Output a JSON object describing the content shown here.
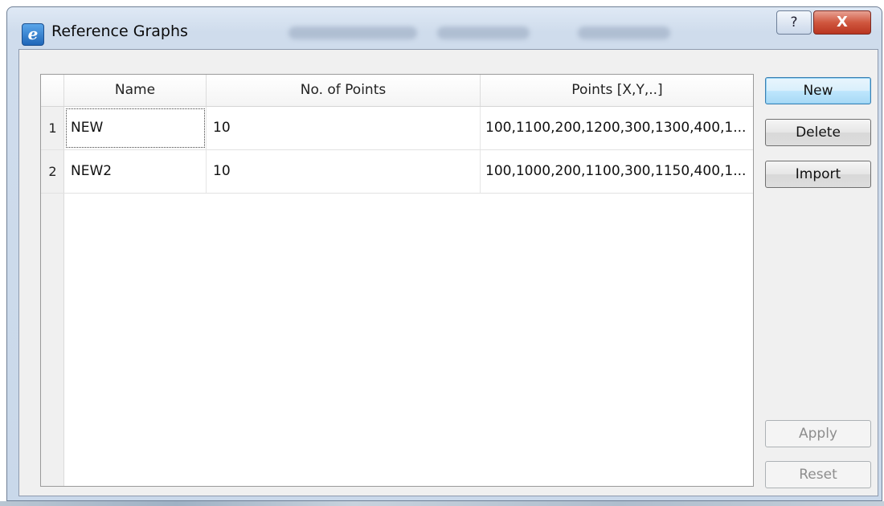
{
  "window": {
    "title": "Reference Graphs",
    "app_icon_glyph": "e",
    "help_glyph": "?",
    "close_glyph": "X"
  },
  "table": {
    "columns": [
      "Name",
      "No. of Points",
      "Points [X,Y,..]"
    ],
    "rows": [
      {
        "index": "1",
        "name": "NEW",
        "points_count": "10",
        "points": "100,1100,200,1200,300,1300,400,1..."
      },
      {
        "index": "2",
        "name": "NEW2",
        "points_count": "10",
        "points": "100,1000,200,1100,300,1150,400,1..."
      }
    ]
  },
  "buttons": {
    "new": "New",
    "delete": "Delete",
    "import": "Import",
    "apply": "Apply",
    "reset": "Reset"
  },
  "colors": {
    "default_button_border": "#3c7fb1",
    "close_button": "#c7432d",
    "disabled_text": "#8d8d8d"
  }
}
